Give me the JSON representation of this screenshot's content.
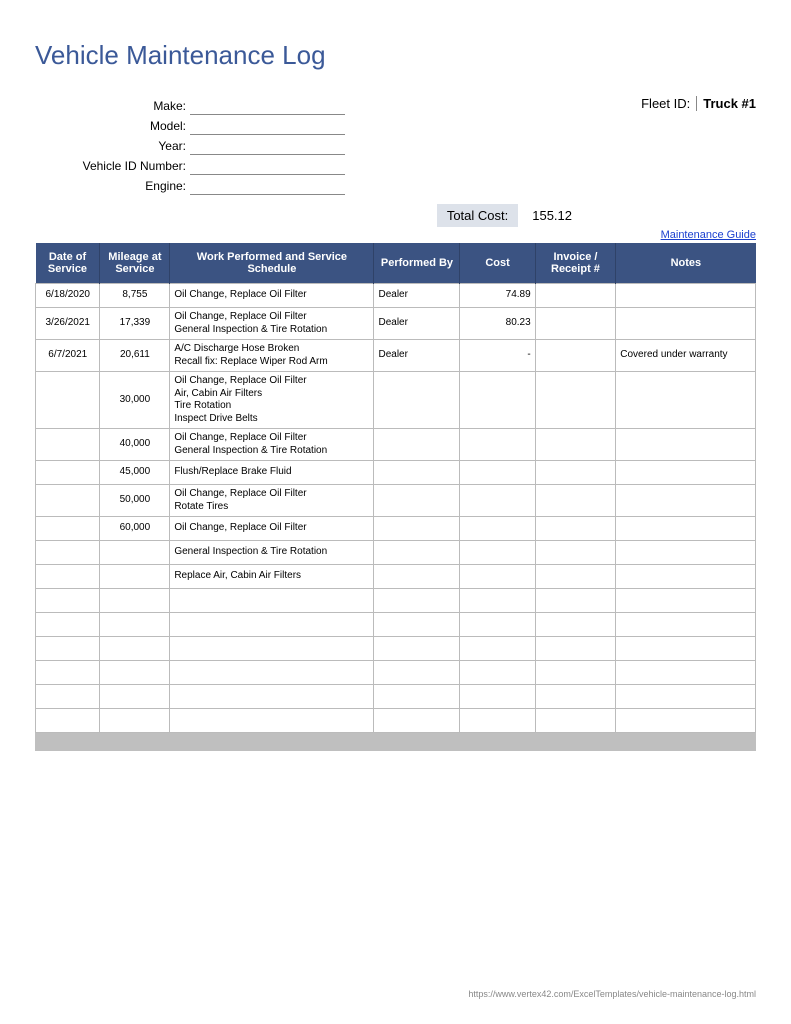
{
  "title": "Vehicle Maintenance Log",
  "fields": {
    "make_label": "Make:",
    "model_label": "Model:",
    "year_label": "Year:",
    "vin_label": "Vehicle ID Number:",
    "engine_label": "Engine:",
    "make": "",
    "model": "",
    "year": "",
    "vin": "",
    "engine": ""
  },
  "fleet": {
    "label": "Fleet ID:",
    "value": "Truck #1"
  },
  "total": {
    "label": "Total Cost:",
    "value": "155.12"
  },
  "guide_link": "Maintenance Guide",
  "headers": {
    "date": "Date of Service",
    "mileage": "Mileage at Service",
    "work": "Work Performed and Service Schedule",
    "performed": "Performed By",
    "cost": "Cost",
    "invoice": "Invoice / Receipt #",
    "notes": "Notes"
  },
  "rows": [
    {
      "date": "6/18/2020",
      "mileage": "8,755",
      "work": "Oil Change, Replace Oil Filter",
      "performed": "Dealer",
      "cost": "74.89",
      "invoice": "",
      "notes": ""
    },
    {
      "date": "3/26/2021",
      "mileage": "17,339",
      "work": "Oil Change, Replace Oil Filter\nGeneral Inspection & Tire Rotation",
      "performed": "Dealer",
      "cost": "80.23",
      "invoice": "",
      "notes": ""
    },
    {
      "date": "6/7/2021",
      "mileage": "20,611",
      "work": "A/C Discharge Hose Broken\nRecall fix: Replace Wiper Rod Arm",
      "performed": "Dealer",
      "cost": "-",
      "invoice": "",
      "notes": "Covered under warranty"
    },
    {
      "date": "",
      "mileage": "30,000",
      "work": "Oil Change, Replace Oil Filter\nAir, Cabin Air Filters\nTire Rotation\nInspect Drive Belts",
      "performed": "",
      "cost": "",
      "invoice": "",
      "notes": ""
    },
    {
      "date": "",
      "mileage": "40,000",
      "work": "Oil Change, Replace Oil Filter\nGeneral Inspection & Tire Rotation",
      "performed": "",
      "cost": "",
      "invoice": "",
      "notes": ""
    },
    {
      "date": "",
      "mileage": "45,000",
      "work": "Flush/Replace Brake Fluid",
      "performed": "",
      "cost": "",
      "invoice": "",
      "notes": ""
    },
    {
      "date": "",
      "mileage": "50,000",
      "work": "Oil Change, Replace Oil Filter\nRotate Tires",
      "performed": "",
      "cost": "",
      "invoice": "",
      "notes": ""
    },
    {
      "date": "",
      "mileage": "60,000",
      "work": "Oil Change, Replace Oil Filter",
      "performed": "",
      "cost": "",
      "invoice": "",
      "notes": ""
    },
    {
      "date": "",
      "mileage": "",
      "work": "General Inspection & Tire Rotation",
      "performed": "",
      "cost": "",
      "invoice": "",
      "notes": ""
    },
    {
      "date": "",
      "mileage": "",
      "work": "Replace Air, Cabin Air Filters",
      "performed": "",
      "cost": "",
      "invoice": "",
      "notes": ""
    },
    {
      "date": "",
      "mileage": "",
      "work": "",
      "performed": "",
      "cost": "",
      "invoice": "",
      "notes": ""
    },
    {
      "date": "",
      "mileage": "",
      "work": "",
      "performed": "",
      "cost": "",
      "invoice": "",
      "notes": ""
    },
    {
      "date": "",
      "mileage": "",
      "work": "",
      "performed": "",
      "cost": "",
      "invoice": "",
      "notes": ""
    },
    {
      "date": "",
      "mileage": "",
      "work": "",
      "performed": "",
      "cost": "",
      "invoice": "",
      "notes": ""
    },
    {
      "date": "",
      "mileage": "",
      "work": "",
      "performed": "",
      "cost": "",
      "invoice": "",
      "notes": ""
    },
    {
      "date": "",
      "mileage": "",
      "work": "",
      "performed": "",
      "cost": "",
      "invoice": "",
      "notes": ""
    }
  ],
  "footer_url": "https://www.vertex42.com/ExcelTemplates/vehicle-maintenance-log.html"
}
